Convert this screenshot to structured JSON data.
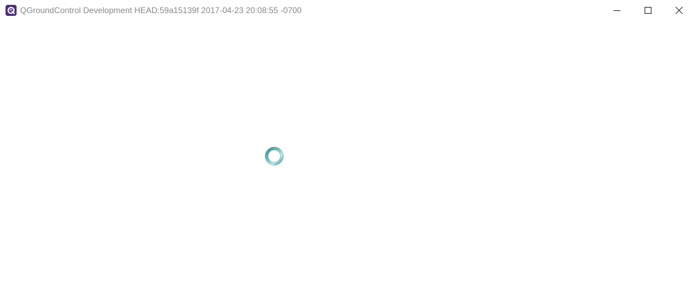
{
  "window": {
    "title": "QGroundControl Development HEAD:59a15139f 2017-04-23 20:08:55 -0700",
    "app_icon": "qgroundcontrol-app-icon",
    "controls": {
      "minimize_icon": "minimize-icon",
      "maximize_icon": "maximize-icon",
      "close_icon": "close-icon"
    }
  },
  "content": {
    "state": "loading",
    "spinner_icon": "loading-spinner-icon",
    "colors": {
      "spinner_ring": "#5aa9a6",
      "spinner_highlight": "#bfe8e6",
      "app_icon_bg": "#4b2f7a"
    }
  }
}
